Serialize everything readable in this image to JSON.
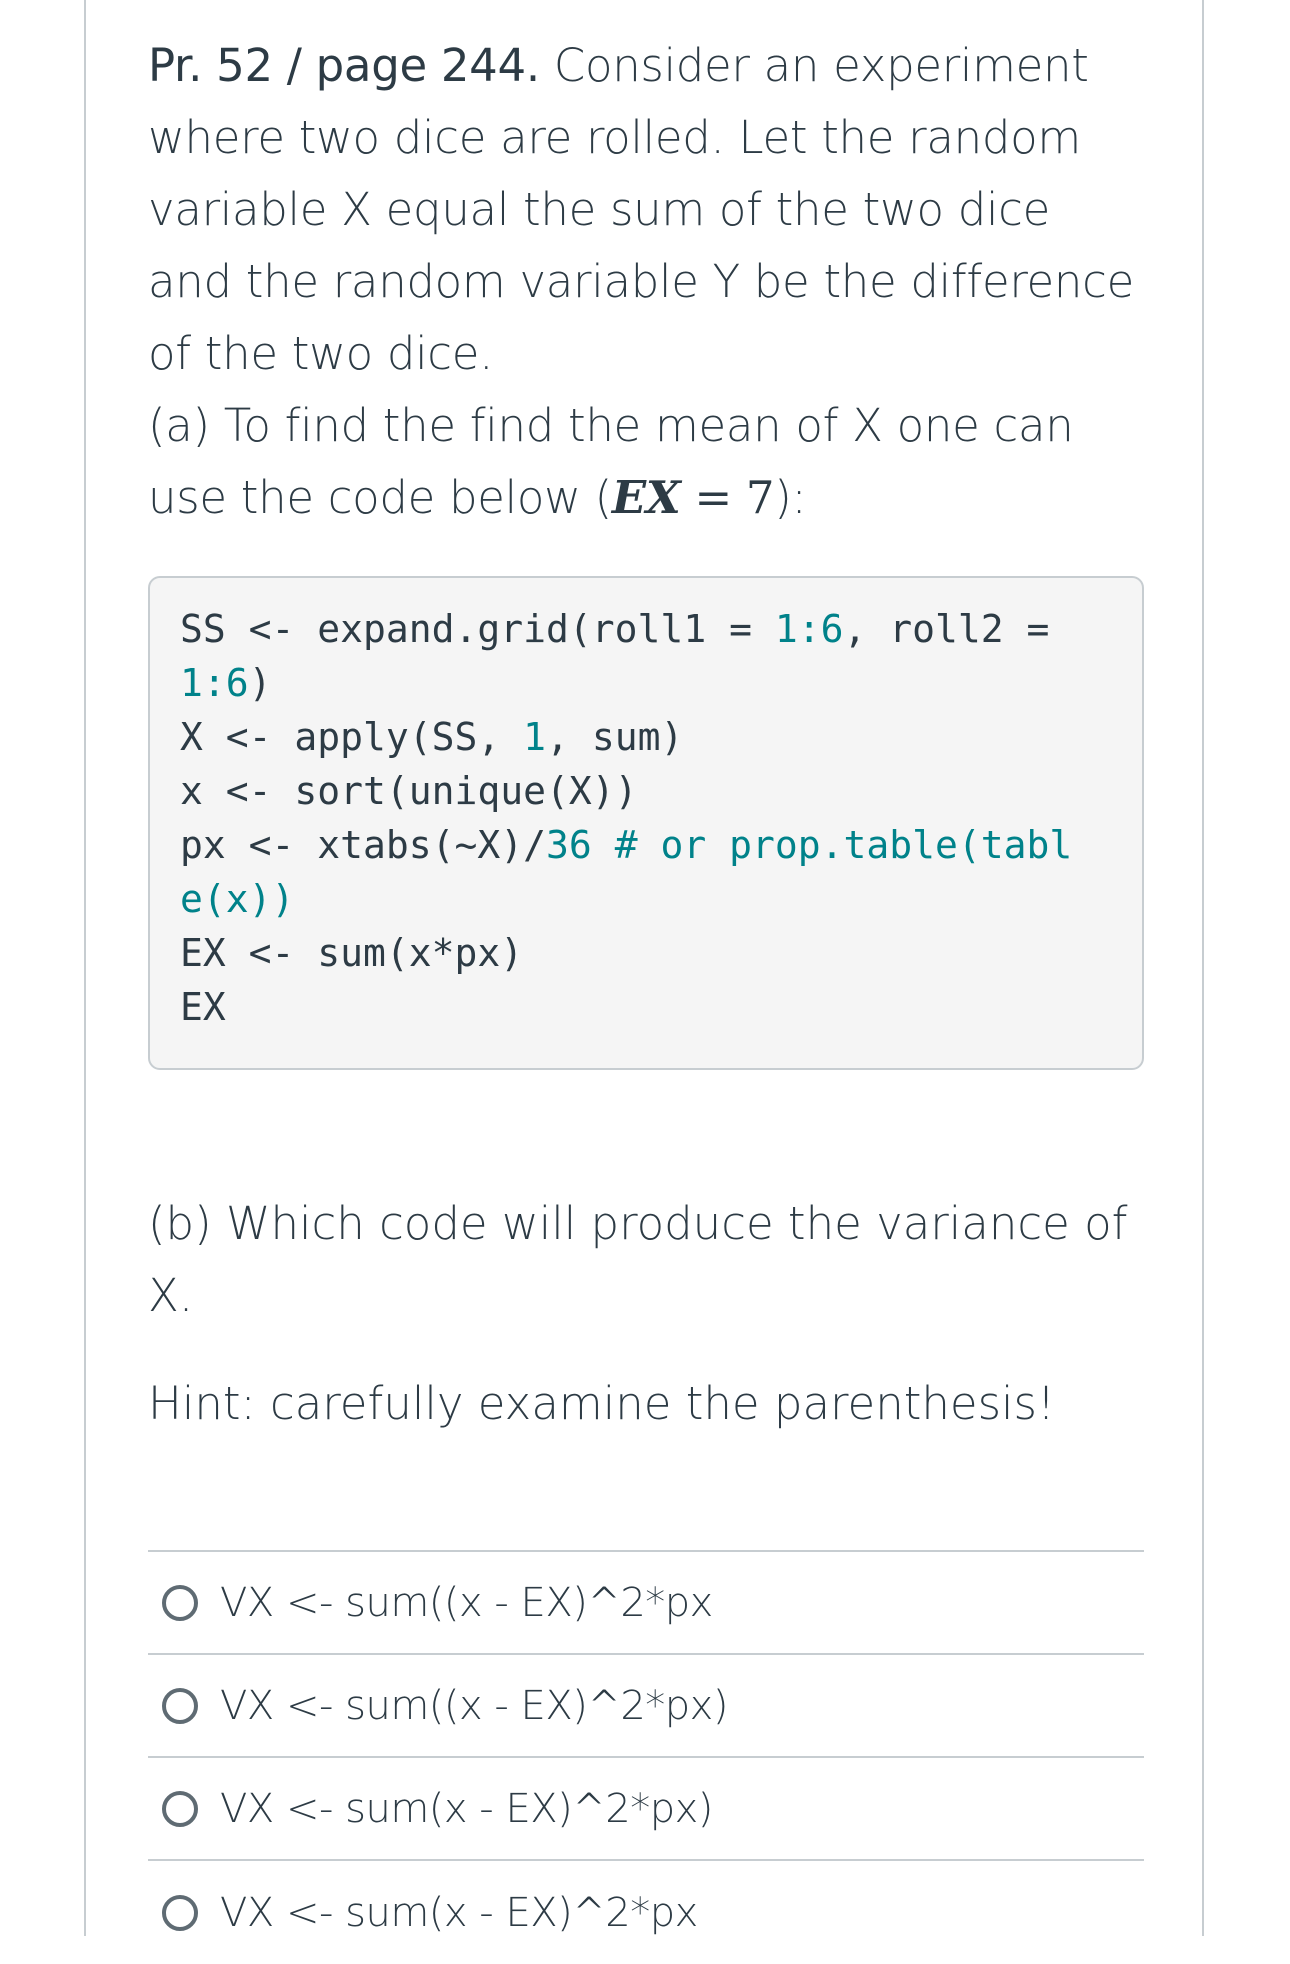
{
  "question": {
    "title_bold": "Pr. 52 / page 244.",
    "intro": " Consider an experiment where two dice are rolled. Let the random variable X equal the sum of the two dice and the random variable Y be the difference of the two dice.",
    "part_a_prefix": "(a) To find the find the mean of X one can use the code below (",
    "part_a_math_var": "EX",
    "part_a_math_eq": " = 7",
    "part_a_suffix": "):",
    "part_b": "(b) Which code will produce the variance of X.",
    "hint": "Hint: carefully examine the parenthesis!"
  },
  "code": {
    "line1_a": "SS <- expand.grid(roll1 = ",
    "line1_b": "1:6",
    "line1_c": ", roll2 =",
    "line2": "1:6",
    "line2_close": ")",
    "line3_a": "X <- apply(SS, ",
    "line3_b": "1",
    "line3_c": ", sum)",
    "line4": "x <- sort(unique(X))",
    "line5_a": "px <- xtabs(~X)/",
    "line5_b": "36",
    "line5_c": " # or prop.table(tabl",
    "line6": "e(x))",
    "line7": "EX <- sum(x*px)",
    "line8": "EX"
  },
  "answers": [
    {
      "label": "VX <- sum((x - EX)^2*px"
    },
    {
      "label": "VX <- sum((x - EX)^2*px)"
    },
    {
      "label": "VX <- sum(x - EX)^2*px)"
    },
    {
      "label": "VX <- sum(x - EX)^2*px"
    }
  ],
  "colors": {
    "text": "#2d3b45",
    "code_accent": "#00828a",
    "border": "#c7cdd1",
    "code_bg": "#f5f5f5"
  }
}
